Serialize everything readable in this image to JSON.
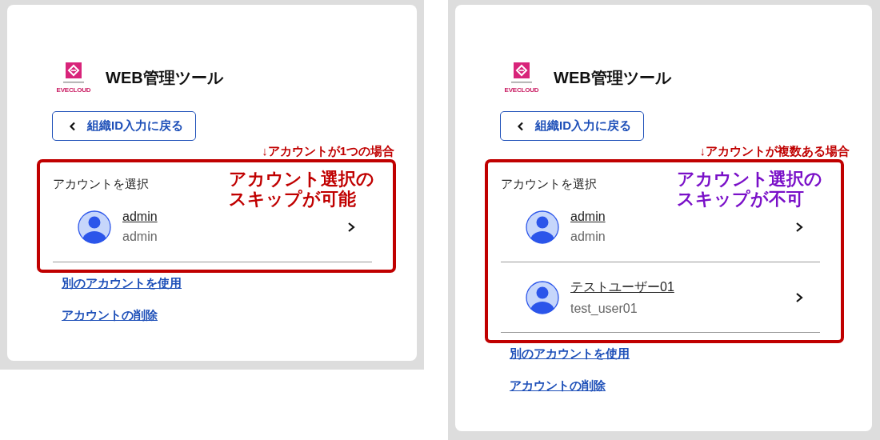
{
  "panels": [
    {
      "logo_text": "EVECLOUD",
      "title": "WEB管理ツール",
      "back_button": "組織ID入力に戻る",
      "note": "↓アカウントが1つの場合",
      "section_label": "アカウントを選択",
      "callout": {
        "text": "アカウント選択のスキップが可能",
        "color": "#c00000"
      },
      "accounts": [
        {
          "name": "admin",
          "id": "admin"
        }
      ],
      "links": [
        "別のアカウントを使用",
        "アカウントの削除"
      ]
    },
    {
      "logo_text": "EVECLOUD",
      "title": "WEB管理ツール",
      "back_button": "組織ID入力に戻る",
      "note": "↓アカウントが複数ある場合",
      "section_label": "アカウントを選択",
      "callout": {
        "text": "アカウント選択のスキップが不可",
        "color": "#7a10c8"
      },
      "accounts": [
        {
          "name": "admin",
          "id": "admin"
        },
        {
          "name": "テストユーザー01",
          "id": "test_user01"
        }
      ],
      "links": [
        "別のアカウントを使用",
        "アカウントの削除"
      ]
    }
  ]
}
